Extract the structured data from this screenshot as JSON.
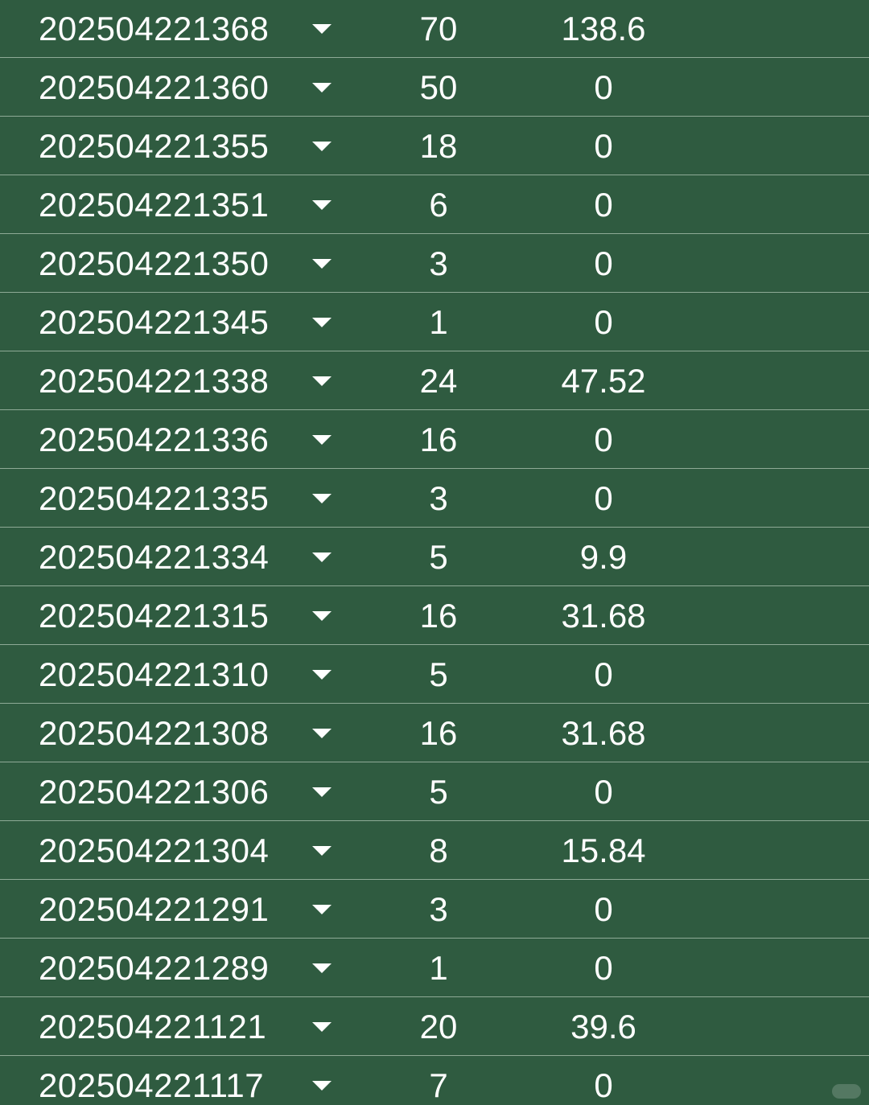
{
  "rows": [
    {
      "id": "202504221368",
      "qty": "70",
      "amount": "138.6"
    },
    {
      "id": "202504221360",
      "qty": "50",
      "amount": "0"
    },
    {
      "id": "202504221355",
      "qty": "18",
      "amount": "0"
    },
    {
      "id": "202504221351",
      "qty": "6",
      "amount": "0"
    },
    {
      "id": "202504221350",
      "qty": "3",
      "amount": "0"
    },
    {
      "id": "202504221345",
      "qty": "1",
      "amount": "0"
    },
    {
      "id": "202504221338",
      "qty": "24",
      "amount": "47.52"
    },
    {
      "id": "202504221336",
      "qty": "16",
      "amount": "0"
    },
    {
      "id": "202504221335",
      "qty": "3",
      "amount": "0"
    },
    {
      "id": "202504221334",
      "qty": "5",
      "amount": "9.9"
    },
    {
      "id": "202504221315",
      "qty": "16",
      "amount": "31.68"
    },
    {
      "id": "202504221310",
      "qty": "5",
      "amount": "0"
    },
    {
      "id": "202504221308",
      "qty": "16",
      "amount": "31.68"
    },
    {
      "id": "202504221306",
      "qty": "5",
      "amount": "0"
    },
    {
      "id": "202504221304",
      "qty": "8",
      "amount": "15.84"
    },
    {
      "id": "202504221291",
      "qty": "3",
      "amount": "0"
    },
    {
      "id": "202504221289",
      "qty": "1",
      "amount": "0"
    },
    {
      "id": "202504221121",
      "qty": "20",
      "amount": "39.6"
    },
    {
      "id": "202504221117",
      "qty": "7",
      "amount": "0"
    }
  ],
  "dropdown_icon": "triangle-down-icon",
  "colors": {
    "background": "#2f5b40",
    "text": "#ffffff",
    "divider": "#9fb8a6"
  }
}
